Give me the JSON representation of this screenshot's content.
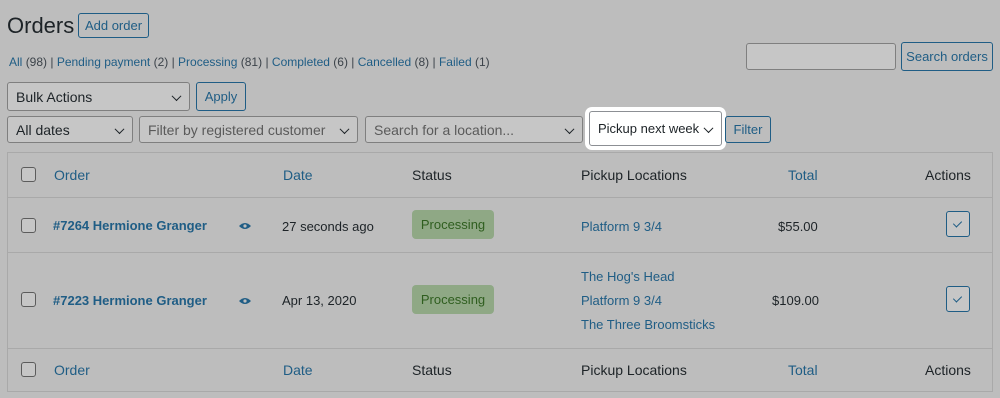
{
  "header": {
    "title": "Orders",
    "add_button": "Add order"
  },
  "filters_links": [
    {
      "label": "All",
      "count": "(98)"
    },
    {
      "label": "Pending payment",
      "count": "(2)"
    },
    {
      "label": "Processing",
      "count": "(81)"
    },
    {
      "label": "Completed",
      "count": "(6)"
    },
    {
      "label": "Cancelled",
      "count": "(8)"
    },
    {
      "label": "Failed",
      "count": "(1)"
    }
  ],
  "search": {
    "value": "",
    "button": "Search orders"
  },
  "bulk": {
    "select": "Bulk Actions",
    "apply": "Apply"
  },
  "filter_bar": {
    "dates": "All dates",
    "customer_placeholder": "Filter by registered customer",
    "location_placeholder": "Search for a location...",
    "pickup": "Pickup next week",
    "button": "Filter"
  },
  "columns": {
    "order": "Order",
    "date": "Date",
    "status": "Status",
    "pickup": "Pickup Locations",
    "total": "Total",
    "actions": "Actions"
  },
  "rows": [
    {
      "order": "#7264 Hermione Granger",
      "date": "27 seconds ago",
      "status": "Processing",
      "locations": [
        "Platform 9 3/4"
      ],
      "total": "$55.00"
    },
    {
      "order": "#7223 Hermione Granger",
      "date": "Apr 13, 2020",
      "status": "Processing",
      "locations": [
        "The Hog's Head",
        "Platform 9 3/4",
        "The Three Broomsticks"
      ],
      "total": "$109.00"
    }
  ],
  "colors": {
    "link": "#1f5d85",
    "status_bg": "#8fa885",
    "status_text": "#2f5e1f",
    "highlight": "#ffffff"
  }
}
